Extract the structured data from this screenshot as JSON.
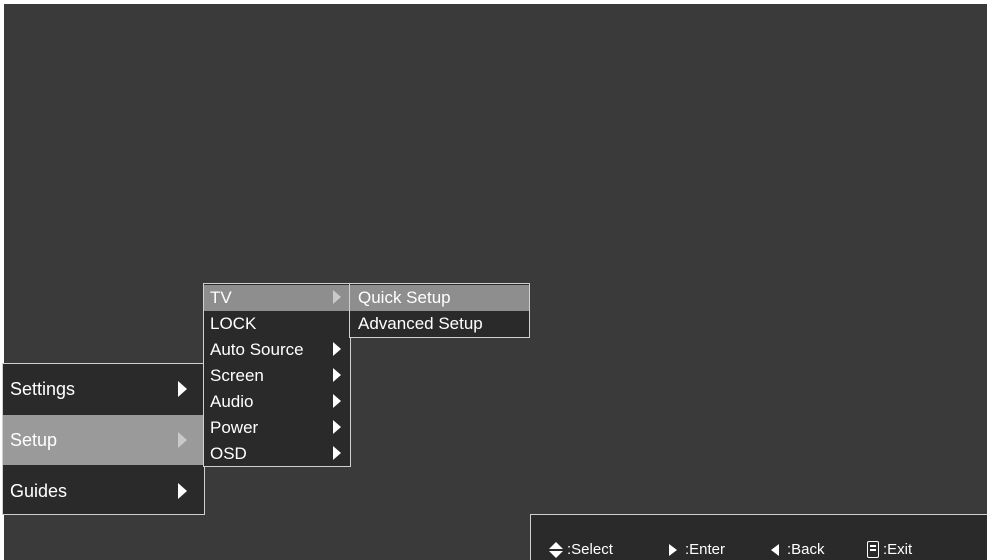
{
  "main_menu": {
    "items": [
      {
        "label": "Settings",
        "selected": false
      },
      {
        "label": "Setup",
        "selected": true
      },
      {
        "label": "Guides",
        "selected": false
      }
    ]
  },
  "setup_menu": {
    "items": [
      {
        "label": "TV",
        "has_submenu": true,
        "selected": true
      },
      {
        "label": "LOCK",
        "has_submenu": false,
        "selected": false
      },
      {
        "label": "Auto Source",
        "has_submenu": true,
        "selected": false
      },
      {
        "label": "Screen",
        "has_submenu": true,
        "selected": false
      },
      {
        "label": "Audio",
        "has_submenu": true,
        "selected": false
      },
      {
        "label": "Power",
        "has_submenu": true,
        "selected": false
      },
      {
        "label": "OSD",
        "has_submenu": true,
        "selected": false
      }
    ]
  },
  "tv_menu": {
    "items": [
      {
        "label": "Quick Setup",
        "selected": true
      },
      {
        "label": "Advanced Setup",
        "selected": false
      }
    ]
  },
  "help_bar": {
    "select": ":Select",
    "enter": ":Enter",
    "back": ":Back",
    "exit": ":Exit"
  },
  "colors": {
    "background": "#3a3a3a",
    "menu_bg": "#2a2a2a",
    "highlight": "#9a9a9a",
    "text": "#ffffff"
  },
  "icons": {
    "select": "up-down-arrows-icon",
    "enter": "right-arrow-icon",
    "back": "left-arrow-icon",
    "exit": "remote-control-icon"
  }
}
